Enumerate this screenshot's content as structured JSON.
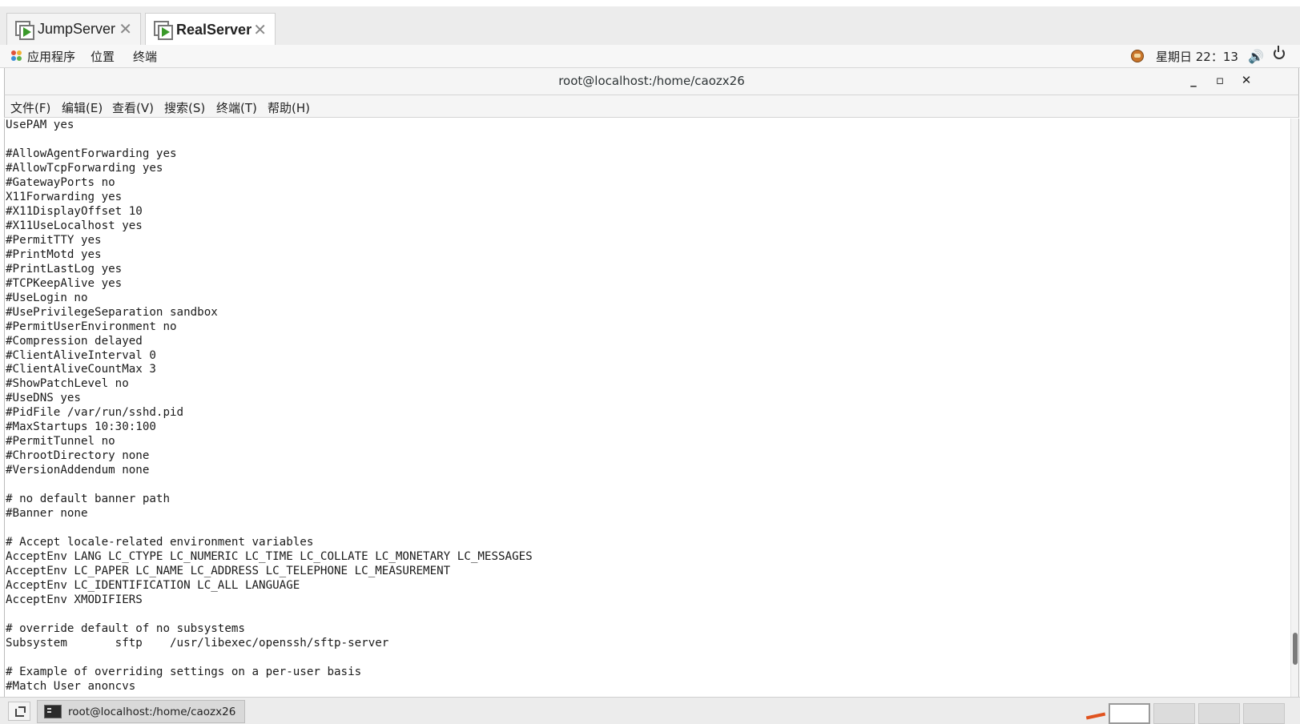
{
  "tabs": [
    {
      "label": "JumpServer",
      "active": false
    },
    {
      "label": "RealServer",
      "active": true
    }
  ],
  "gnome_bar": {
    "apps": "应用程序",
    "places": "位置",
    "terminal": "终端",
    "clock": "星期日 22：13"
  },
  "window": {
    "title": "root@localhost:/home/caozx26",
    "minimize": "_",
    "maximize": "▫",
    "close": "✕"
  },
  "menu": {
    "file": "文件(F)",
    "edit": "编辑(E)",
    "view": "查看(V)",
    "search": "搜索(S)",
    "terminal": "终端(T)",
    "help": "帮助(H)"
  },
  "terminal_lines": [
    "UsePAM yes",
    "",
    "#AllowAgentForwarding yes",
    "#AllowTcpForwarding yes",
    "#GatewayPorts no",
    "X11Forwarding yes",
    "#X11DisplayOffset 10",
    "#X11UseLocalhost yes",
    "#PermitTTY yes",
    "#PrintMotd yes",
    "#PrintLastLog yes",
    "#TCPKeepAlive yes",
    "#UseLogin no",
    "#UsePrivilegeSeparation sandbox",
    "#PermitUserEnvironment no",
    "#Compression delayed",
    "#ClientAliveInterval 0",
    "#ClientAliveCountMax 3",
    "#ShowPatchLevel no",
    "#UseDNS yes",
    "#PidFile /var/run/sshd.pid",
    "#MaxStartups 10:30:100",
    "#PermitTunnel no",
    "#ChrootDirectory none",
    "#VersionAddendum none",
    "",
    "# no default banner path",
    "#Banner none",
    "",
    "# Accept locale-related environment variables",
    "AcceptEnv LANG LC_CTYPE LC_NUMERIC LC_TIME LC_COLLATE LC_MONETARY LC_MESSAGES",
    "AcceptEnv LC_PAPER LC_NAME LC_ADDRESS LC_TELEPHONE LC_MEASUREMENT",
    "AcceptEnv LC_IDENTIFICATION LC_ALL LANGUAGE",
    "AcceptEnv XMODIFIERS",
    "",
    "# override default of no subsystems",
    "Subsystem       sftp    /usr/libexec/openssh/sftp-server",
    "",
    "# Example of overriding settings on a per-user basis",
    "#Match User anoncvs"
  ],
  "taskbar": {
    "window_label": "root@localhost:/home/caozx26"
  },
  "icons": {
    "tab_icon": "vm-icon",
    "apps": "apps-icon",
    "tray": "avatar-icon",
    "volume": "volume-icon",
    "power": "power-icon",
    "show_desktop": "show-desktop-icon",
    "task": "terminal-icon"
  },
  "colors": {
    "accent_green": "#3a9a2a",
    "marker": "#e0531f"
  }
}
